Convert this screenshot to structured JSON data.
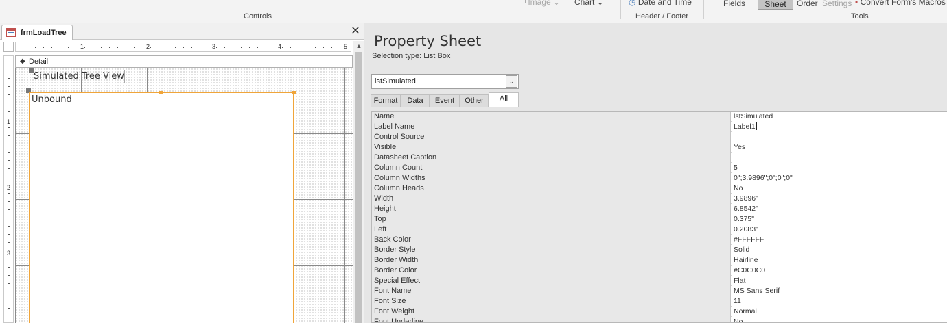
{
  "ribbon": {
    "image_label": "Image",
    "chart_label": "Chart",
    "date_time_label": "Date and Time",
    "fields_label": "Fields",
    "sheet_label": "Sheet",
    "order_label": "Order",
    "settings_label": "Settings",
    "convert_label": "Convert Form's Macros",
    "group_controls": "Controls",
    "group_header_footer": "Header / Footer",
    "group_tools": "Tools"
  },
  "document": {
    "tab_label": "frmLoadTree",
    "section_label": "Detail",
    "label_control_text": "Simulated Tree View",
    "listbox_text": "Unbound",
    "h_ruler_numbers": [
      "1",
      "2",
      "3",
      "4",
      "5"
    ],
    "v_ruler_numbers": [
      "1",
      "2",
      "3"
    ]
  },
  "property_sheet": {
    "title": "Property Sheet",
    "selection_type": "Selection type:  List Box",
    "selected_control": "lstSimulated",
    "tabs": [
      "Format",
      "Data",
      "Event",
      "Other",
      "All"
    ],
    "active_tab": "All",
    "properties": [
      {
        "name": "Name",
        "value": "lstSimulated"
      },
      {
        "name": "Label Name",
        "value": "Label1"
      },
      {
        "name": "Control Source",
        "value": ""
      },
      {
        "name": "Visible",
        "value": "Yes"
      },
      {
        "name": "Datasheet Caption",
        "value": ""
      },
      {
        "name": "Column Count",
        "value": "5"
      },
      {
        "name": "Column Widths",
        "value": "0\";3.9896\";0\";0\";0\""
      },
      {
        "name": "Column Heads",
        "value": "No"
      },
      {
        "name": "Width",
        "value": "3.9896\""
      },
      {
        "name": "Height",
        "value": "6.8542\""
      },
      {
        "name": "Top",
        "value": "0.375\""
      },
      {
        "name": "Left",
        "value": "0.2083\""
      },
      {
        "name": "Back Color",
        "value": "#FFFFFF"
      },
      {
        "name": "Border Style",
        "value": "Solid"
      },
      {
        "name": "Border Width",
        "value": "Hairline"
      },
      {
        "name": "Border Color",
        "value": "#C0C0C0"
      },
      {
        "name": "Special Effect",
        "value": "Flat"
      },
      {
        "name": "Font Name",
        "value": "MS Sans Serif"
      },
      {
        "name": "Font Size",
        "value": "11"
      },
      {
        "name": "Font Weight",
        "value": "Normal"
      },
      {
        "name": "Font Underline",
        "value": "No"
      }
    ]
  },
  "colors": {
    "selection_orange": "#f0a53a",
    "pane_gray": "#e6e6e6",
    "sheet_button": "#c4c4c4"
  }
}
